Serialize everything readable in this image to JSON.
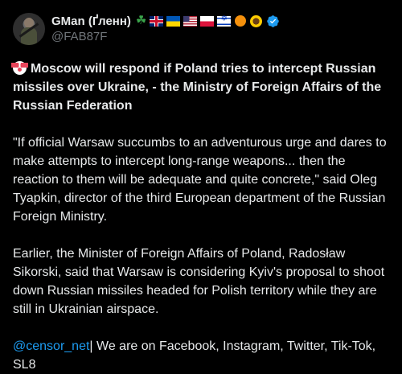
{
  "author": {
    "display_name": "GMan (Ґленн)",
    "handle": "@FAB87F",
    "badges": [
      "shamrock-icon",
      "flag-uk-icon",
      "flag-ua-icon",
      "flag-us-icon",
      "flag-pl-icon",
      "flag-il-icon",
      "orange-circle-icon",
      "sunflower-icon"
    ],
    "verified": true,
    "verified_color": "#1d9bf0"
  },
  "tweet": {
    "headline_emoji": "clown-face-icon",
    "headline": "Moscow will respond if Poland tries to intercept Russian missiles over Ukraine, - the Ministry of Foreign Affairs of the Russian Federation",
    "paragraph_1": "\"If official Warsaw succumbs to an adventurous urge and dares to make attempts to intercept long-range weapons... then the reaction to them will be adequate and quite concrete,\" said Oleg Tyapkin, director of the third European department of the Russian Foreign Ministry.",
    "paragraph_2": "Earlier, the Minister of Foreign Affairs of Poland, Radosław Sikorski, said that Warsaw is considering Kyiv's proposal to shoot down Russian missiles headed for Polish territory while they are still in Ukrainian airspace.",
    "mention": "@censor_net",
    "footer_text": "| We are on Facebook, Instagram, Twitter, Tik-Tok, SL8"
  },
  "colors": {
    "background": "#000000",
    "text": "#e7e9ea",
    "secondary_text": "#71767b",
    "link": "#1d9bf0"
  }
}
